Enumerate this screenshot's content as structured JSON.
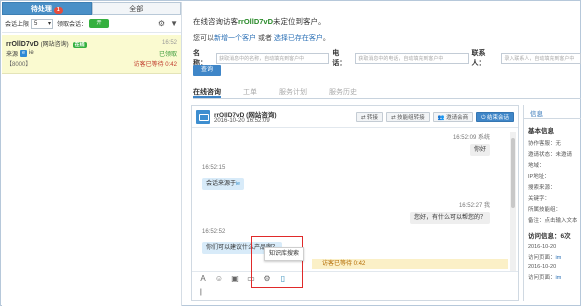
{
  "left": {
    "tabs": [
      {
        "label": "待处理",
        "badge": "1"
      },
      {
        "label": "全部"
      }
    ],
    "session_limit_label": "会话上限",
    "session_limit_value": "5",
    "receive_label": "领取会话：",
    "receive_toggle": "开",
    "session": {
      "name": "rrOllD7vD",
      "tag": "(网站咨询)",
      "status": "在线",
      "time": "16:52",
      "source_label": "来源",
      "source_value": "ie",
      "received": "已领取",
      "code": "【8000】",
      "wait": "访客已等待 0:42"
    }
  },
  "right": {
    "notice_prefix": "在线咨询访客",
    "notice_name": "rrOllD7vD",
    "notice_suffix": "未定位到客户。",
    "newcust_text_a": "您可以",
    "newcust_link_a": "新增一个客户",
    "newcust_text_b": "或者",
    "newcust_link_b": "选择已存在客户",
    "newcust_text_c": "。",
    "name_label": "名称：",
    "name_placeholder": "获取消息中的名称，自动填充到客户中",
    "phone_label": "电话：",
    "phone_placeholder": "获取消息中的电话，自动填充到客户中",
    "contact_label": "联系人：",
    "contact_placeholder": "录入联系人，自动填充到客户中",
    "query_button": "查询",
    "subtabs": [
      "在线咨询",
      "工单",
      "服务计划",
      "服务历史"
    ],
    "chat": {
      "visitor": "rrOllD7vD (网站咨询)",
      "start_time": "2016-10-20 16:52:09",
      "buttons": [
        "转接",
        "技能组转接",
        "邀请会商",
        "结束会话"
      ],
      "messages": [
        {
          "time": "16:52:09",
          "sender": "系统",
          "side": "right",
          "text": "你好"
        },
        {
          "time": "16:52:15",
          "side": "left",
          "text": "会话来源于",
          "extra": "ie"
        },
        {
          "time": "16:52:27",
          "sender": "我",
          "side": "right",
          "text": "您好，有什么可以帮您的？"
        },
        {
          "time": "16:52:52",
          "side": "left",
          "text": "你们可以建议什么产品啊？"
        }
      ],
      "wait_text": "访客已等待 0:42",
      "tooltip": "知识库搜索",
      "toolbar_icons": [
        "font-icon",
        "emoji-icon",
        "image-icon",
        "folder-icon",
        "gear-icon",
        "book-icon"
      ]
    },
    "info": {
      "tab": "信息",
      "title": "基本信息",
      "rows": [
        "协作客服：无",
        "邀请状态：未邀请",
        "地域：",
        "IP地址：",
        "搜索来源：",
        "关键字：",
        "所属技能组：",
        "备注：点击输入文本"
      ],
      "visit_title": "访问信息：6次",
      "visits": [
        {
          "time": "2016-10-20",
          "page": "访问页面：",
          "link": "im"
        },
        {
          "time": "2016-10-20",
          "page": "访问页面：",
          "link": "im"
        }
      ]
    }
  }
}
